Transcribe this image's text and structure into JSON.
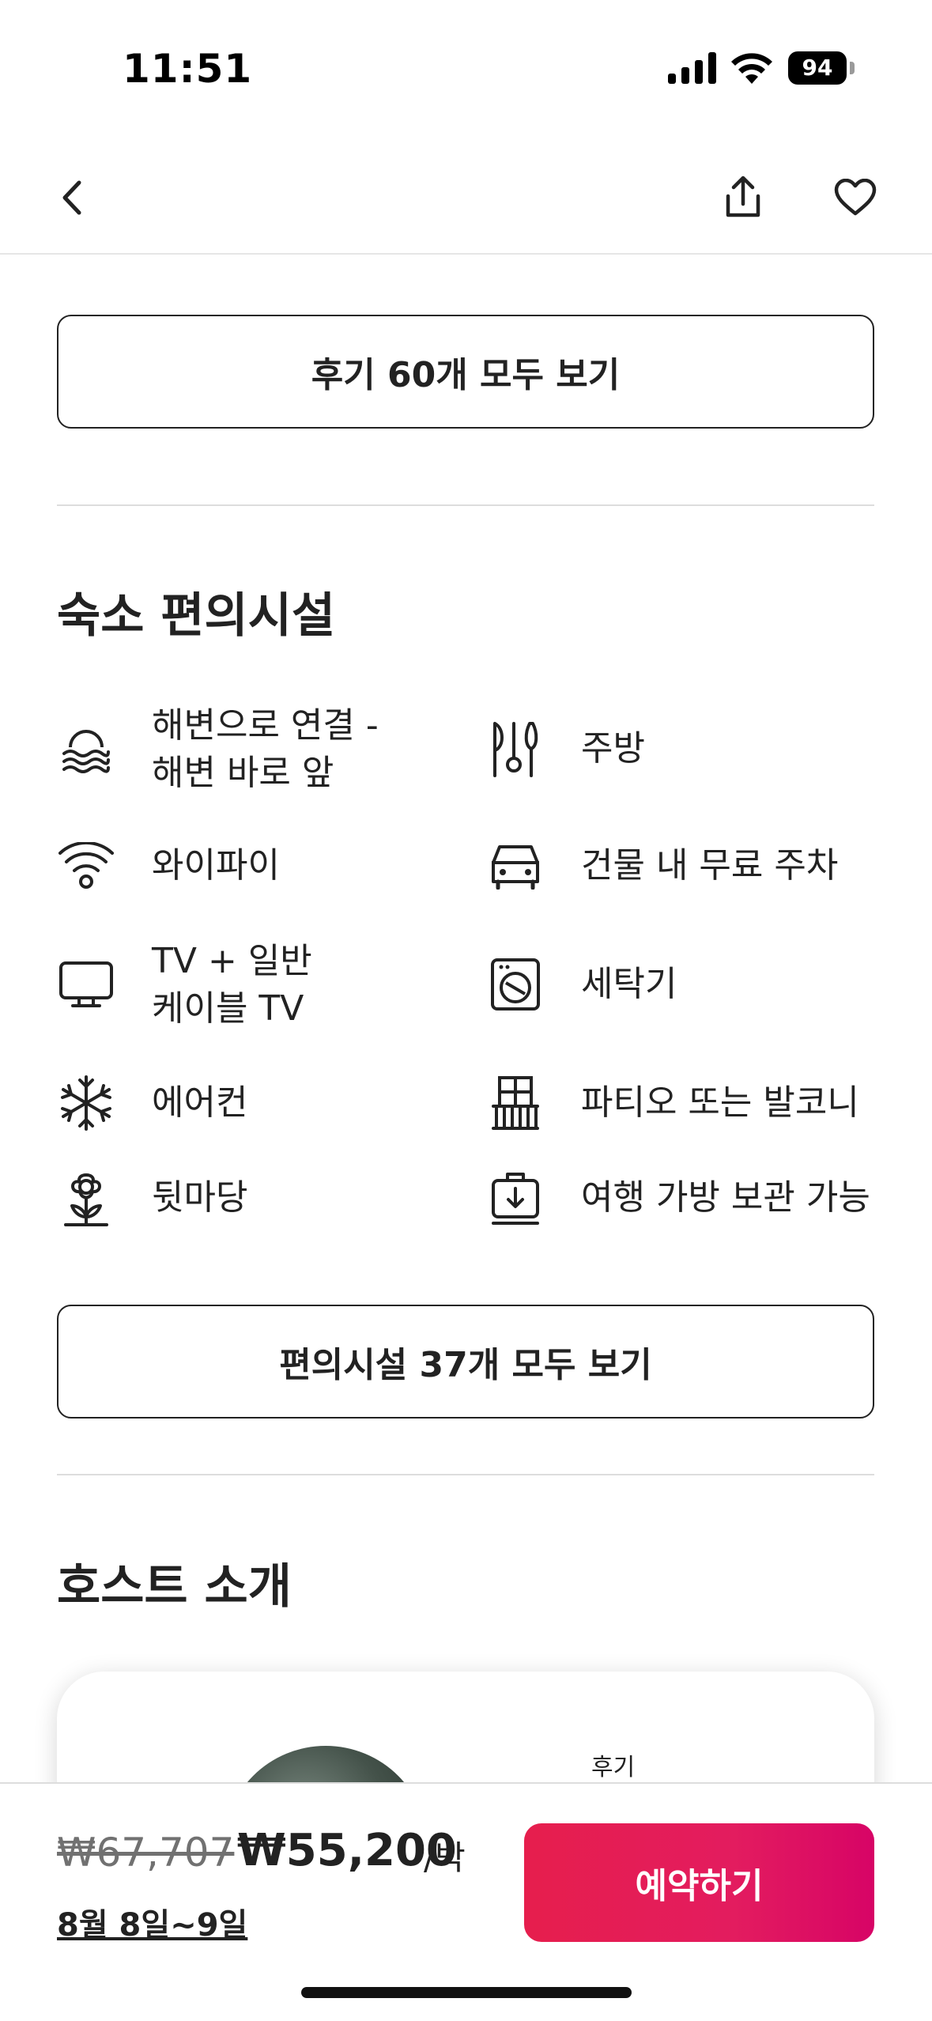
{
  "status_bar": {
    "time": "11:51",
    "battery": "94"
  },
  "reviews": {
    "button_label": "후기 60개 모두 보기"
  },
  "amenities": {
    "title": "숙소 편의시설",
    "items": [
      {
        "label": "해변으로 연결 -\n해변 바로 앞",
        "icon": "beach-waves-icon"
      },
      {
        "label": "주방",
        "icon": "kitchen-utensils-icon"
      },
      {
        "label": "와이파이",
        "icon": "wifi-icon"
      },
      {
        "label": "건물 내 무료 주차",
        "icon": "car-icon"
      },
      {
        "label": "TV + 일반\n케이블 TV",
        "icon": "tv-icon"
      },
      {
        "label": "세탁기",
        "icon": "washer-icon"
      },
      {
        "label": "에어컨",
        "icon": "snowflake-icon"
      },
      {
        "label": "파티오 또는 발코니",
        "icon": "balcony-icon"
      },
      {
        "label": "뒷마당",
        "icon": "flower-icon"
      },
      {
        "label": "여행 가방 보관 가능",
        "icon": "luggage-icon"
      }
    ],
    "button_label": "편의시설 37개 모두 보기"
  },
  "host": {
    "title": "호스트 소개",
    "reviews_label": "후기"
  },
  "footer": {
    "original_price": "₩67,707",
    "price": "₩55,200",
    "per_night": "/박",
    "dates": "8월 8일~9일",
    "reserve_label": "예약하기"
  },
  "colors": {
    "accent": "#E31C5F",
    "text": "#222222",
    "muted": "#717171",
    "divider": "#DDDDDD"
  }
}
